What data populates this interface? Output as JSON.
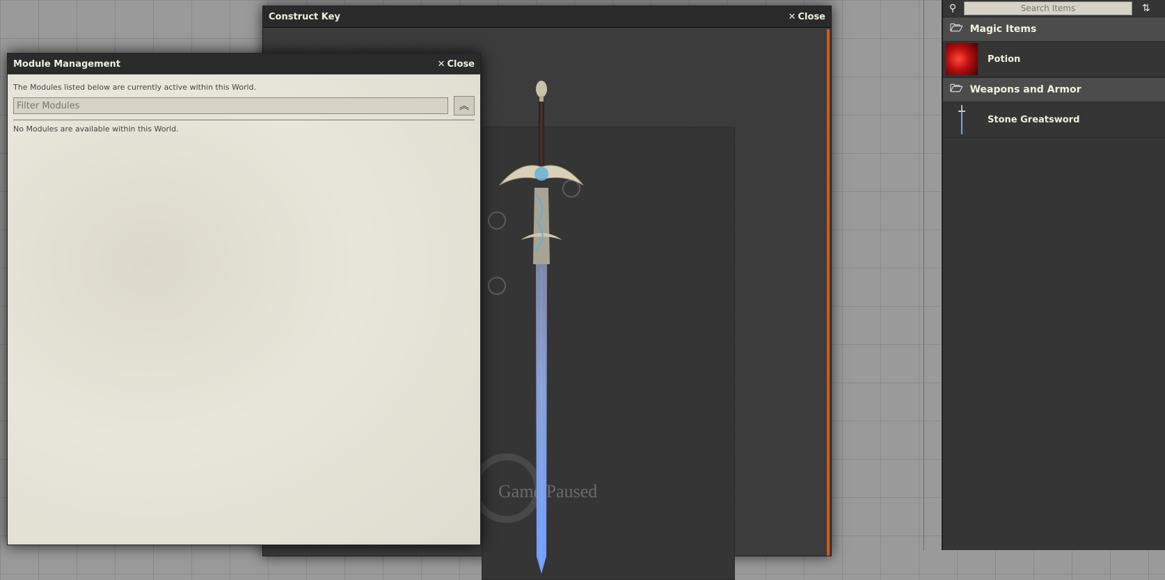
{
  "construct_key": {
    "title": "Construct Key",
    "close_label": "Close",
    "pause_text": "Game Paused"
  },
  "module_management": {
    "title": "Module Management",
    "close_label": "Close",
    "note": "The Modules listed below are currently active within this World.",
    "filter_placeholder": "Filter Modules",
    "empty_message": "No Modules are available within this World."
  },
  "sidebar": {
    "search_placeholder": "Search Items",
    "folders": [
      {
        "label": "Magic Items",
        "items": [
          {
            "label": "Potion",
            "icon": "potion-icon"
          }
        ]
      },
      {
        "label": "Weapons and Armor",
        "items": [
          {
            "label": "Stone Greatsword",
            "icon": "sword-icon"
          }
        ]
      }
    ]
  },
  "colors": {
    "accent_orange": "#d45a1a",
    "parchment": "#e6e3d6",
    "dark_panel": "#353535"
  }
}
